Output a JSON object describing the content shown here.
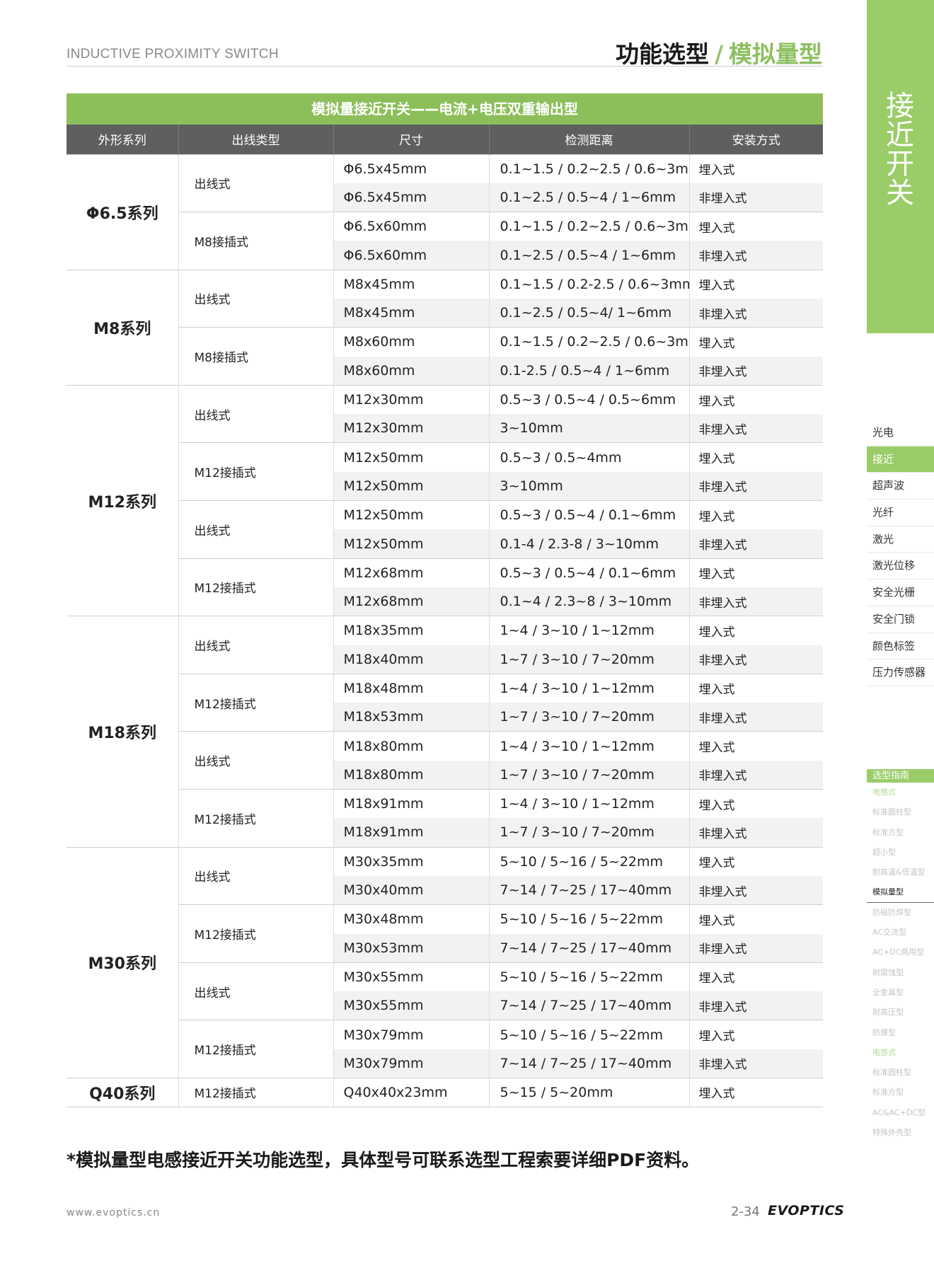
{
  "header": {
    "left": "INDUCTIVE PROXIMITY SWITCH",
    "title_main": "功能选型",
    "title_sep": "/",
    "title_sub": "模拟量型"
  },
  "band_label": "接近开关",
  "nav": {
    "items": [
      "光电",
      "接近",
      "超声波",
      "光纤",
      "激光",
      "激光位移",
      "安全光栅",
      "安全门锁",
      "颜色标签",
      "压力传感器"
    ],
    "active_index": 1
  },
  "guide": {
    "title": "选型指南",
    "items": [
      "电感式",
      "标准圆柱型",
      "标准方型",
      "超小型",
      "耐高温&低温型",
      "模拟量型",
      "防磁防焊型",
      "AC交流型",
      "AC+DC两用型",
      "耐腐蚀型",
      "全金属型",
      "耐高压型",
      "防爆型",
      "电感式",
      "标准圆柱型",
      "标准方型",
      "AC&AC+DC型",
      "特殊外壳型"
    ]
  },
  "table": {
    "title": "模拟量接近开关——电流+电压双重输出型",
    "headers": [
      "外形系列",
      "出线类型",
      "尺寸",
      "检测距离",
      "安装方式"
    ],
    "groups": [
      {
        "series": "Φ6.5系列",
        "subgroups": [
          {
            "wire": "出线式",
            "rows": [
              [
                "Φ6.5x45mm",
                "0.1~1.5 / 0.2~2.5 / 0.6~3mm",
                "埋入式"
              ],
              [
                "Φ6.5x45mm",
                "0.1~2.5 / 0.5~4 / 1~6mm",
                "非埋入式"
              ]
            ]
          },
          {
            "wire": "M8接插式",
            "rows": [
              [
                "Φ6.5x60mm",
                "0.1~1.5 / 0.2~2.5 / 0.6~3mm",
                "埋入式"
              ],
              [
                "Φ6.5x60mm",
                "0.1~2.5 / 0.5~4 / 1~6mm",
                "非埋入式"
              ]
            ]
          }
        ]
      },
      {
        "series": "M8系列",
        "subgroups": [
          {
            "wire": "出线式",
            "rows": [
              [
                "M8x45mm",
                "0.1~1.5 / 0.2-2.5 / 0.6~3mm",
                "埋入式"
              ],
              [
                "M8x45mm",
                "0.1~2.5 / 0.5~4/ 1~6mm",
                "非埋入式"
              ]
            ]
          },
          {
            "wire": "M8接插式",
            "rows": [
              [
                "M8x60mm",
                "0.1~1.5 / 0.2~2.5 / 0.6~3mm",
                "埋入式"
              ],
              [
                "M8x60mm",
                "0.1-2.5 / 0.5~4 / 1~6mm",
                "非埋入式"
              ]
            ]
          }
        ]
      },
      {
        "series": "M12系列",
        "subgroups": [
          {
            "wire": "出线式",
            "rows": [
              [
                "M12x30mm",
                "0.5~3 / 0.5~4 / 0.5~6mm",
                "埋入式"
              ],
              [
                "M12x30mm",
                "3~10mm",
                "非埋入式"
              ]
            ]
          },
          {
            "wire": "M12接插式",
            "rows": [
              [
                "M12x50mm",
                "0.5~3 / 0.5~4mm",
                "埋入式"
              ],
              [
                "M12x50mm",
                "3~10mm",
                "非埋入式"
              ]
            ]
          },
          {
            "wire": "出线式",
            "rows": [
              [
                "M12x50mm",
                "0.5~3 / 0.5~4 / 0.1~6mm",
                "埋入式"
              ],
              [
                "M12x50mm",
                "0.1-4 / 2.3-8 / 3~10mm",
                "非埋入式"
              ]
            ]
          },
          {
            "wire": "M12接插式",
            "rows": [
              [
                "M12x68mm",
                "0.5~3 / 0.5~4 / 0.1~6mm",
                "埋入式"
              ],
              [
                "M12x68mm",
                "0.1~4 / 2.3~8 / 3~10mm",
                "非埋入式"
              ]
            ]
          }
        ]
      },
      {
        "series": "M18系列",
        "subgroups": [
          {
            "wire": "出线式",
            "rows": [
              [
                "M18x35mm",
                "1~4 / 3~10 / 1~12mm",
                "埋入式"
              ],
              [
                "M18x40mm",
                "1~7 / 3~10 / 7~20mm",
                "非埋入式"
              ]
            ]
          },
          {
            "wire": "M12接插式",
            "rows": [
              [
                "M18x48mm",
                "1~4 / 3~10 / 1~12mm",
                "埋入式"
              ],
              [
                "M18x53mm",
                "1~7 / 3~10 / 7~20mm",
                "非埋入式"
              ]
            ]
          },
          {
            "wire": "出线式",
            "rows": [
              [
                "M18x80mm",
                "1~4 / 3~10 / 1~12mm",
                "埋入式"
              ],
              [
                "M18x80mm",
                "1~7 / 3~10 / 7~20mm",
                "非埋入式"
              ]
            ]
          },
          {
            "wire": "M12接插式",
            "rows": [
              [
                "M18x91mm",
                "1~4 / 3~10 / 1~12mm",
                "埋入式"
              ],
              [
                "M18x91mm",
                "1~7 / 3~10 / 7~20mm",
                "非埋入式"
              ]
            ]
          }
        ]
      },
      {
        "series": "M30系列",
        "subgroups": [
          {
            "wire": "出线式",
            "rows": [
              [
                "M30x35mm",
                "5~10 / 5~16 / 5~22mm",
                "埋入式"
              ],
              [
                "M30x40mm",
                "7~14 / 7~25 / 17~40mm",
                "非埋入式"
              ]
            ]
          },
          {
            "wire": "M12接插式",
            "rows": [
              [
                "M30x48mm",
                "5~10 / 5~16 / 5~22mm",
                "埋入式"
              ],
              [
                "M30x53mm",
                "7~14 / 7~25 / 17~40mm",
                "非埋入式"
              ]
            ]
          },
          {
            "wire": "出线式",
            "rows": [
              [
                "M30x55mm",
                "5~10 / 5~16 / 5~22mm",
                "埋入式"
              ],
              [
                "M30x55mm",
                "7~14 / 7~25 / 17~40mm",
                "非埋入式"
              ]
            ]
          },
          {
            "wire": "M12接插式",
            "rows": [
              [
                "M30x79mm",
                "5~10 / 5~16 / 5~22mm",
                "埋入式"
              ],
              [
                "M30x79mm",
                "7~14 / 7~25 / 17~40mm",
                "非埋入式"
              ]
            ]
          }
        ]
      },
      {
        "series": "Q40系列",
        "subgroups": [
          {
            "wire": "M12接插式",
            "rows": [
              [
                "Q40x40x23mm",
                "5~15 / 5~20mm",
                "埋入式"
              ]
            ]
          }
        ]
      }
    ]
  },
  "note": "*模拟量型电感接近开关功能选型，具体型号可联系选型工程索要详细PDF资料。",
  "footer": {
    "url": "www.evoptics.cn",
    "page": "2-34",
    "brand": "EVOPTICS"
  }
}
